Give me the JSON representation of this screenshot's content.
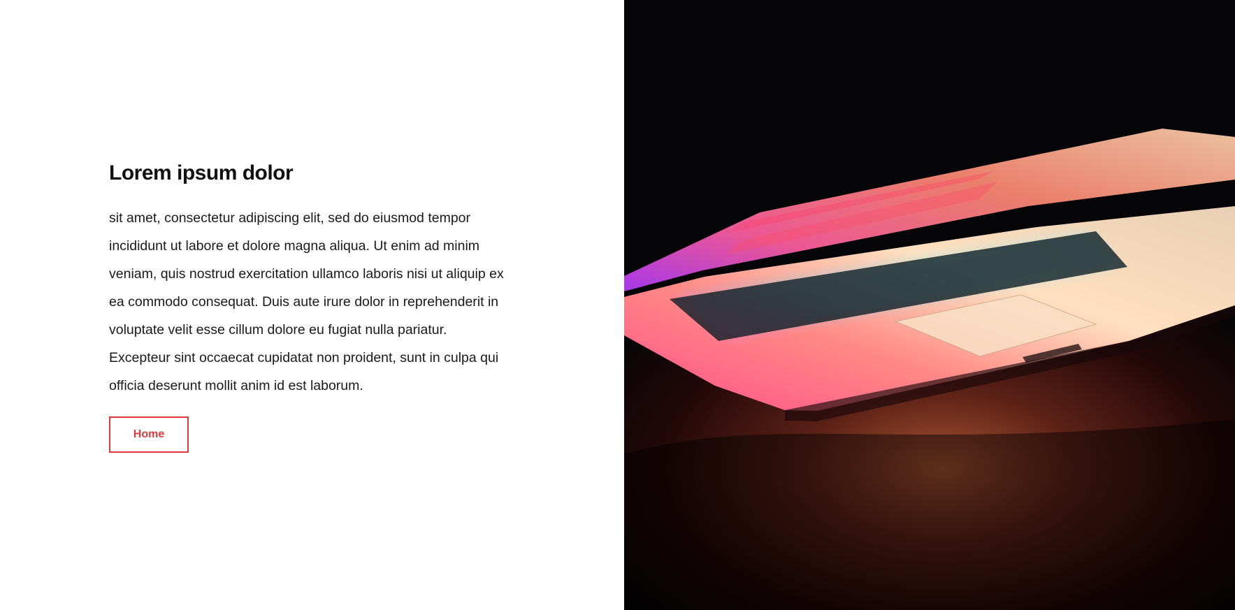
{
  "hero": {
    "title": "Lorem ipsum dolor",
    "body": "sit amet, consectetur adipiscing elit, sed do eiusmod tempor incididunt ut labore et dolore magna aliqua. Ut enim ad minim veniam, quis nostrud exercitation ullamco laboris nisi ut aliquip ex ea commodo consequat. Duis aute irure dolor in reprehenderit in voluptate velit esse cillum dolore eu fugiat nulla pariatur. Excepteur sint occaecat cupidatat non proident, sunt in culpa qui officia deserunt mollit anim id est laborum.",
    "button_label": "Home"
  },
  "colors": {
    "accent": "#e03a3a",
    "text": "#111111",
    "image_background": "#050507"
  }
}
